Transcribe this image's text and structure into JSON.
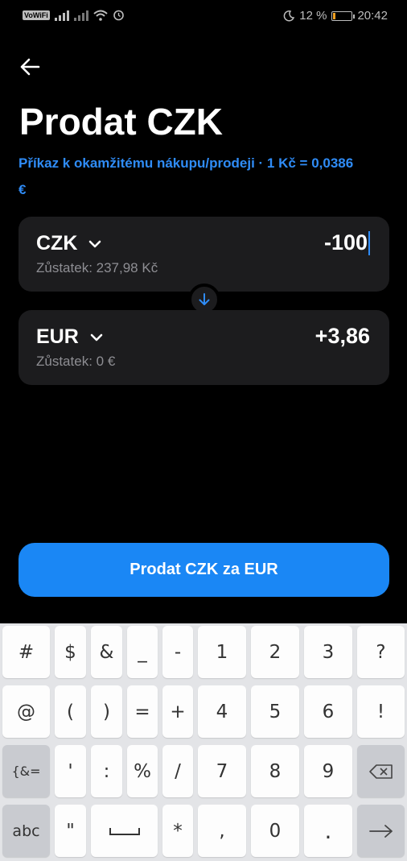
{
  "status_bar": {
    "volte": "VoWiFi",
    "battery_percent": "12 %",
    "battery_level": 0.12,
    "time": "20:42",
    "icons": [
      "signal-icon",
      "wifi-icon",
      "alarm-icon",
      "moon-icon",
      "battery-icon"
    ]
  },
  "header": {
    "title": "Prodat CZK",
    "rate_text": "Příkaz k okamžitému nákupu/prodeji · 1 Kč = 0,0386 €"
  },
  "from": {
    "currency": "CZK",
    "balance": "Zůstatek: 237,98 Kč",
    "amount": "-100"
  },
  "to": {
    "currency": "EUR",
    "balance": "Zůstatek: 0 €",
    "amount": "+3,86"
  },
  "action": {
    "submit_label": "Prodat CZK za EUR"
  },
  "keyboard": {
    "keys": [
      "#",
      "$",
      "&",
      "_",
      "-",
      "1",
      "2",
      "3",
      "?",
      "@",
      "(",
      ")",
      "=",
      "+",
      "4",
      "5",
      "6",
      "!",
      "{&=",
      "'",
      ":",
      "%",
      "/",
      "7",
      "8",
      "9",
      "abc",
      "\"",
      "*",
      ",",
      "0"
    ]
  },
  "colors": {
    "accent": "#1a87f5",
    "link": "#2f8cf7",
    "card": "#1c1c1e",
    "battery": "#f0a020"
  }
}
